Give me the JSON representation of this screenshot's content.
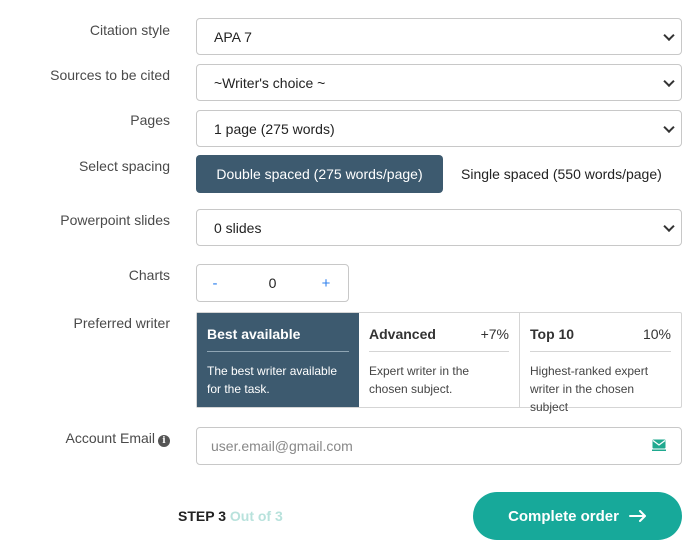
{
  "citation_style": {
    "label": "Citation style",
    "value": "APA 7"
  },
  "sources": {
    "label": "Sources to be cited",
    "value": "~Writer's choice ~"
  },
  "pages": {
    "label": "Pages",
    "value": "1 page (275 words)"
  },
  "spacing": {
    "label": "Select spacing",
    "options": [
      "Double spaced (275 words/page)",
      "Single spaced (550 words/page)"
    ],
    "selected": "Double spaced (275 words/page)"
  },
  "slides": {
    "label": "Powerpoint slides",
    "value": "0 slides"
  },
  "charts": {
    "label": "Charts",
    "minus": "-",
    "value": "0",
    "plus": "+"
  },
  "writer": {
    "label": "Preferred writer",
    "options": [
      {
        "title": "Best available",
        "price": "",
        "desc": "The best writer available for the task."
      },
      {
        "title": "Advanced",
        "price": "+7%",
        "desc": "Expert writer in the chosen subject."
      },
      {
        "title": "Top 10",
        "price": "10%",
        "desc": "Highest-ranked expert writer in the chosen subject"
      }
    ],
    "selected": "Best available"
  },
  "email": {
    "label": "Account Email",
    "placeholder": "user.email@gmail.com"
  },
  "footer": {
    "step_label": "STEP 3",
    "step_total": "Out of 3",
    "complete_label": "Complete order"
  },
  "colors": {
    "accent": "#3d5a6f",
    "cta": "#17a99a",
    "muted_step": "#b8e2dc"
  }
}
